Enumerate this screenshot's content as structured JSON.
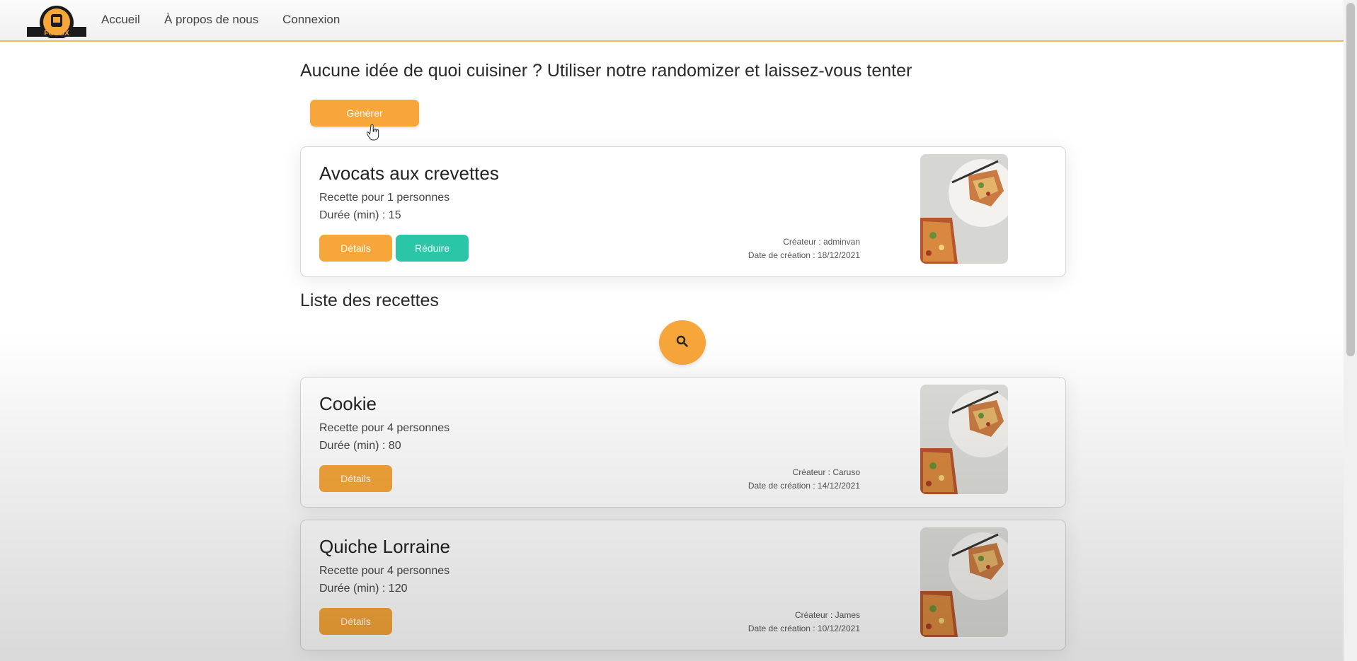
{
  "nav": {
    "logo_text": "FOODX",
    "links": [
      "Accueil",
      "À propos de nous",
      "Connexion"
    ]
  },
  "randomizer": {
    "heading": "Aucune idée de quoi cuisiner ? Utiliser notre randomizer et laissez-vous tenter",
    "generate_label": "Générer"
  },
  "random_recipe": {
    "title": "Avocats aux crevettes",
    "servings": "Recette pour 1 personnes",
    "duration": "Durée (min) : 15",
    "details_label": "Détails",
    "reduce_label": "Réduire",
    "creator": "Créateur : adminvan",
    "created": "Date de création : 18/12/2021"
  },
  "list": {
    "heading": "Liste des recettes",
    "search_icon": "search-icon",
    "recipes": [
      {
        "title": "Cookie",
        "servings": "Recette pour 4 personnes",
        "duration": "Durée (min) : 80",
        "details_label": "Détails",
        "creator": "Créateur : Caruso",
        "created": "Date de création : 14/12/2021"
      },
      {
        "title": "Quiche Lorraine",
        "servings": "Recette pour 4 personnes",
        "duration": "Durée (min) : 120",
        "details_label": "Détails",
        "creator": "Créateur : James",
        "created": "Date de création : 10/12/2021"
      }
    ]
  },
  "colors": {
    "accent_orange": "#f7a63a",
    "accent_teal": "#2bc5a7",
    "nav_border": "#f4b564"
  }
}
